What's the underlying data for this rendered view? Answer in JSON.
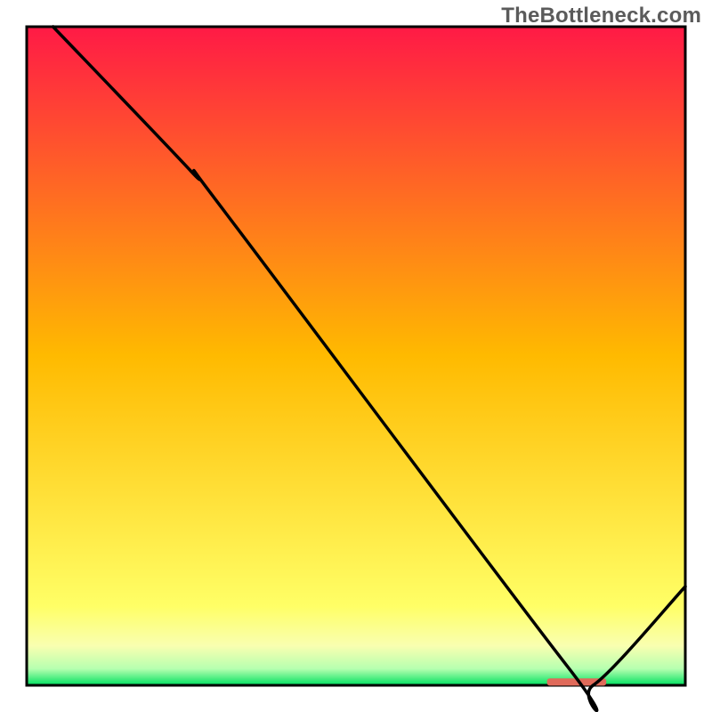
{
  "watermark": "TheBottleneck.com",
  "chart_data": {
    "type": "line",
    "title": "",
    "xlabel": "",
    "ylabel": "",
    "xlim": [
      0,
      100
    ],
    "ylim": [
      0,
      100
    ],
    "grid": false,
    "legend": false,
    "background_gradient": {
      "stops": [
        {
          "offset": 0.0,
          "color": "#ff1a46"
        },
        {
          "offset": 0.5,
          "color": "#ffba00"
        },
        {
          "offset": 0.88,
          "color": "#ffff66"
        },
        {
          "offset": 0.94,
          "color": "#f9ffb0"
        },
        {
          "offset": 0.975,
          "color": "#b6ffb0"
        },
        {
          "offset": 1.0,
          "color": "#00e060"
        }
      ]
    },
    "series": [
      {
        "name": "curve",
        "color": "#000000",
        "points_xy": [
          [
            4,
            100
          ],
          [
            25,
            78
          ],
          [
            30,
            72
          ],
          [
            82,
            3
          ],
          [
            86,
            0
          ],
          [
            100,
            15
          ]
        ]
      }
    ],
    "marker": {
      "name": "optimal-range",
      "color": "#e06a5a",
      "x_start": 79,
      "x_end": 88,
      "y": 0.5,
      "thickness_pct": 1.1
    }
  }
}
